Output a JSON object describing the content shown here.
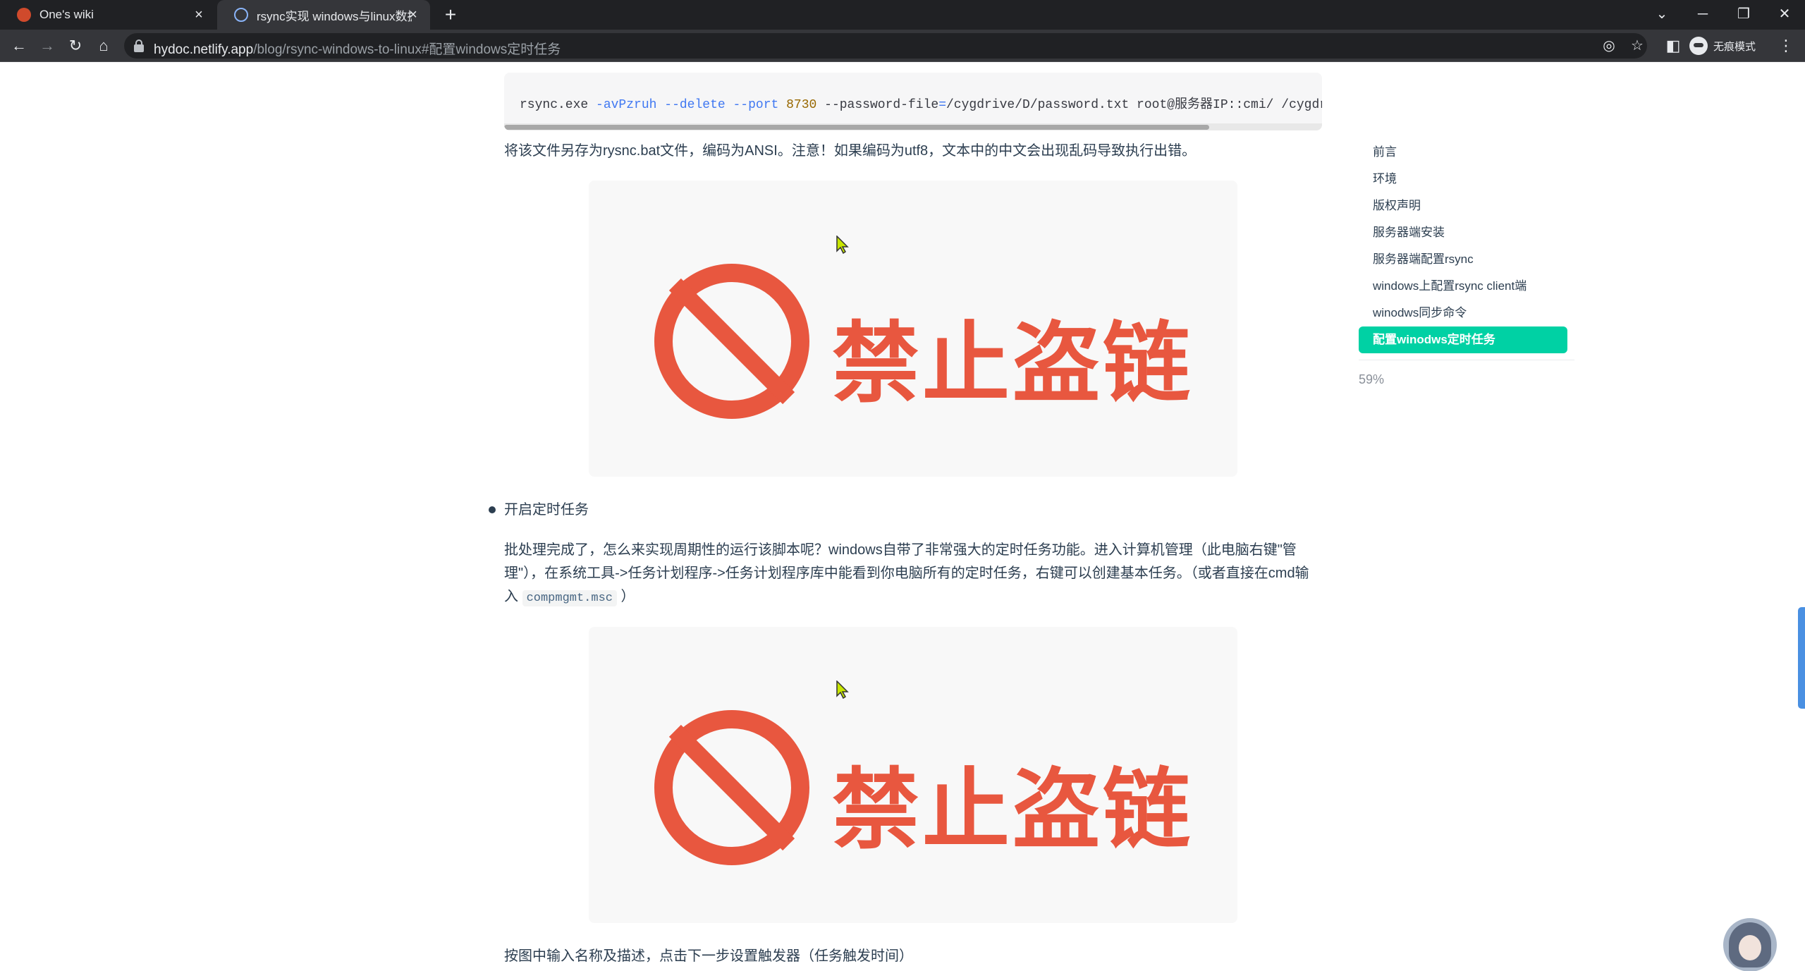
{
  "browser": {
    "tabs": [
      {
        "title": "One's wiki",
        "active": false
      },
      {
        "title": "rsync实现 windows与linux数据",
        "active": true
      }
    ],
    "url_host": "hydoc.netlify.app",
    "url_path": "/blog/rsync-windows-to-linux#配置windows定时任务",
    "profile_label": "无痕模式"
  },
  "article": {
    "code": {
      "cmd": "rsync.exe",
      "flag1": "-avPzruh",
      "flag2": "--delete",
      "flag3": "--port",
      "port": "8730",
      "rest_a": "--password-file",
      "eq": "=",
      "rest_b": "/cygdrive/D/password.txt root@服务器IP::cmi/ /cygdrive"
    },
    "para1": "将该文件另存为rysnc.bat文件，编码为ANSI。注意！如果编码为utf8，文本中的中文会出现乱码导致执行出错。",
    "image_text": "禁止盗链",
    "bullet1": "开启定时任务",
    "para2": "批处理完成了，怎么来实现周期性的运行该脚本呢？windows自带了非常强大的定时任务功能。进入计算机管理（此电脑右键\"管理\"），在系统工具->任务计划程序->任务计划程序库中能看到你电脑所有的定时任务，右键可以创建基本任务。（或者直接在cmd输入",
    "para2_code": "compmgmt.msc",
    "para2_end": "）",
    "para3": "按图中输入名称及描述，点击下一步设置触发器（任务触发时间）"
  },
  "toc": {
    "items": [
      {
        "label": "前言",
        "active": false
      },
      {
        "label": "环境",
        "active": false
      },
      {
        "label": "版权声明",
        "active": false
      },
      {
        "label": "服务器端安装",
        "active": false
      },
      {
        "label": "服务器端配置rsync",
        "active": false
      },
      {
        "label": "windows上配置rsync client端",
        "active": false
      },
      {
        "label": "winodws同步命令",
        "active": false
      },
      {
        "label": "配置winodws定时任务",
        "active": true
      }
    ],
    "progress": "59%"
  },
  "colors": {
    "accent": "#00d1a4",
    "ban_red": "#e8573f"
  }
}
